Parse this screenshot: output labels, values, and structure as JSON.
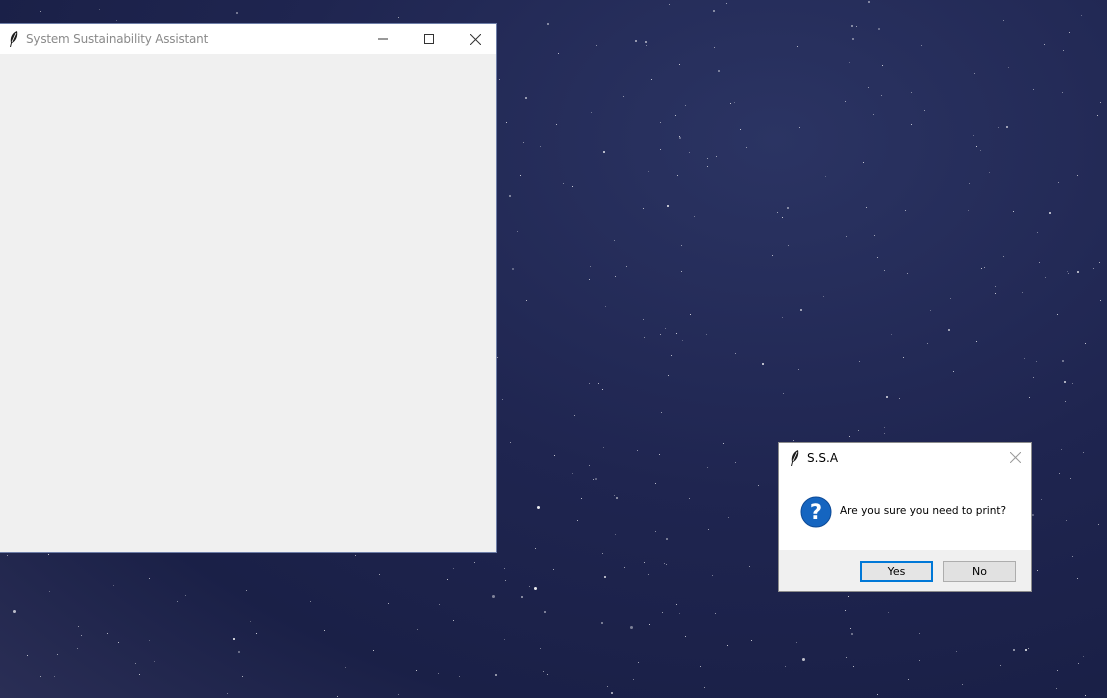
{
  "main_window": {
    "title": "System Sustainability Assistant",
    "icon": "feather-icon",
    "controls": [
      "minimize-icon",
      "maximize-icon",
      "close-icon"
    ]
  },
  "dialog": {
    "title": "S.S.A",
    "icon": "feather-icon",
    "message_icon": "question-icon",
    "message": "Are you sure you need to print?",
    "buttons": {
      "yes_label": "Yes",
      "no_label": "No"
    }
  },
  "colors": {
    "accent": "#0078d7",
    "question_icon": "#1565c0",
    "window_background": "#f0f0f0",
    "desktop": "#1f2550"
  }
}
